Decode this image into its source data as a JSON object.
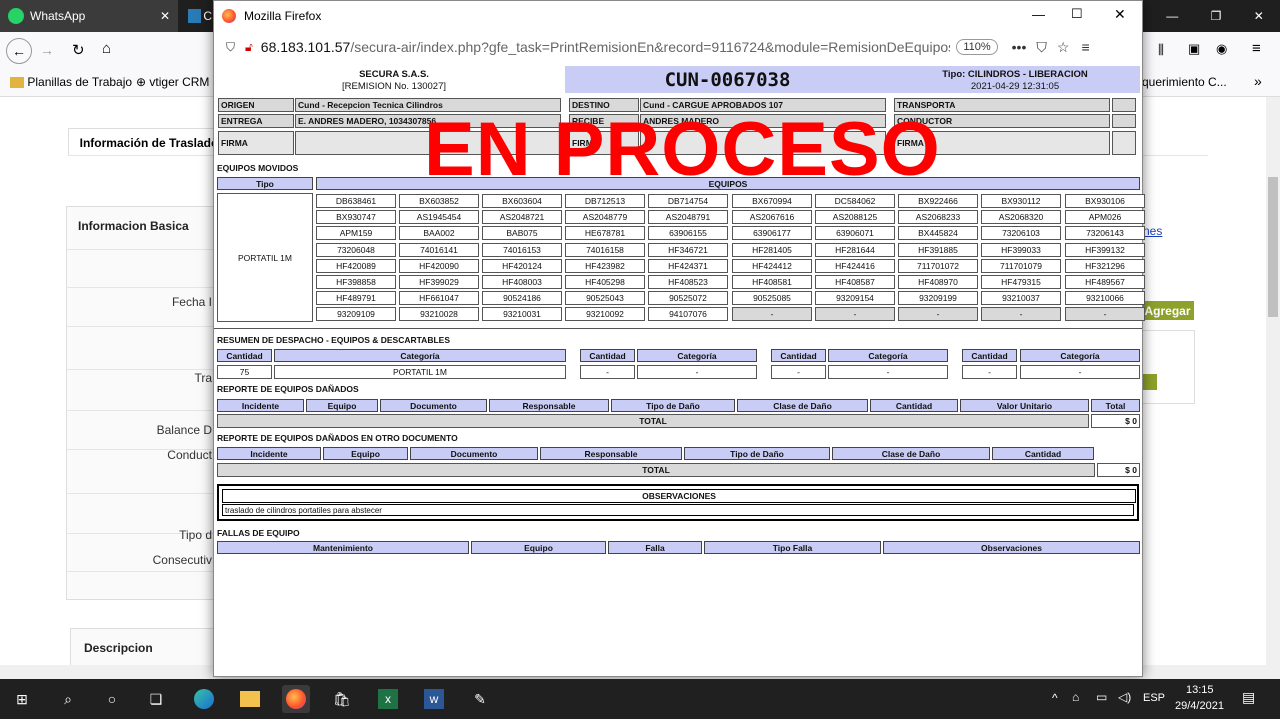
{
  "bg_tabs": {
    "whatsapp": "WhatsApp",
    "partial": "C"
  },
  "bg_bookmarks": {
    "planillas": "Planillas de Trabajo",
    "vtiger": "vtiger CRM",
    "right": "querimiento C..."
  },
  "bg_page": {
    "tab_title": "Información de Traslado",
    "section_basic": "Informacion Basica",
    "labels": [
      "Fecha I",
      "Tra",
      "Balance D",
      "Conduct",
      "Tipo d",
      "Consecutiv"
    ],
    "link_right": "nes",
    "button_agregar": "Agregar",
    "section_desc": "Descripcion"
  },
  "ff": {
    "title": "Mozilla Firefox",
    "url_host": "68.183.101.57",
    "url_path": "/secura-air/index.php?gfe_task=PrintRemisionEn&record=9116724&module=RemisionDeEquipos&actio",
    "zoom": "110%"
  },
  "doc": {
    "company": "SECURA S.A.S.",
    "remision": "[REMISION No. 130027]",
    "code": "CUN-0067038",
    "tipo": "Tipo: CILINDROS - LIBERACION",
    "datetime": "2021-04-29 12:31:05",
    "watermark": "EN PROCESO",
    "origen_label": "ORIGEN",
    "origen_value": "Cund - Recepcion Tecnica Cilindros",
    "destino_label": "DESTINO",
    "destino_value": "Cund - CARGUE APROBADOS 107",
    "transporta_label": "TRANSPORTA",
    "entrega_label": "ENTREGA",
    "entrega_value": "E. ANDRES MADERO, 1034307856",
    "recibe_label": "RECIBE",
    "recibe_value": "ANDRES MADERO",
    "conductor_label": "CONDUCTOR",
    "firma_label": "FIRMA",
    "equipos_movidos": "EQUIPOS MOVIDOS",
    "col_tipo": "Tipo",
    "col_equipos": "EQUIPOS",
    "tipo_value": "PORTATIL 1M",
    "equipos": [
      [
        "DB638461",
        "BX603852",
        "BX603604",
        "DB712513",
        "DB714754",
        "BX670994",
        "DC584062",
        "BX922466",
        "BX930112",
        "BX930106"
      ],
      [
        "BX930747",
        "AS1945454",
        "AS2048721",
        "AS2048779",
        "AS2048791",
        "AS2067616",
        "AS2088125",
        "AS2068233",
        "AS2068320",
        "APM026"
      ],
      [
        "APM159",
        "BAA002",
        "BAB075",
        "HE678781",
        "63906155",
        "63906177",
        "63906071",
        "BX445824",
        "73206103",
        "73206143"
      ],
      [
        "73206048",
        "74016141",
        "74016153",
        "74016158",
        "HF346721",
        "HF281405",
        "HF281644",
        "HF391885",
        "HF399033",
        "HF399132"
      ],
      [
        "HF420089",
        "HF420090",
        "HF420124",
        "HF423982",
        "HF424371",
        "HF424412",
        "HF424416",
        "711701072",
        "711701079",
        "HF321296"
      ],
      [
        "HF398858",
        "HF399029",
        "HF408003",
        "HF405298",
        "HF408523",
        "HF408581",
        "HF408587",
        "HF408970",
        "HF479315",
        "HF489567"
      ],
      [
        "HF489791",
        "HF661047",
        "90524186",
        "90525043",
        "90525072",
        "90525085",
        "93209154",
        "93209199",
        "93210037",
        "93210066"
      ],
      [
        "93209109",
        "93210028",
        "93210031",
        "93210092",
        "94107076",
        "-",
        "-",
        "-",
        "-",
        "-"
      ]
    ],
    "resumen_title": "RESUMEN DE DESPACHO - EQUIPOS & DESCARTABLES",
    "col_cantidad": "Cantidad",
    "col_categoria": "Categoría",
    "resumen_cantidad": "75",
    "resumen_categoria": "PORTATIL 1M",
    "dash": "-",
    "danados_title": "REPORTE DE EQUIPOS DAÑADOS",
    "danados_cols": [
      "Incidente",
      "Equipo",
      "Documento",
      "Responsable",
      "Tipo de Daño",
      "Clase de Daño",
      "Cantidad",
      "Valor Unitario",
      "Total"
    ],
    "total_label": "TOTAL",
    "total_value": "$ 0",
    "otro_title": "REPORTE DE EQUIPOS DAÑADOS EN OTRO DOCUMENTO",
    "otro_cols": [
      "Incidente",
      "Equipo",
      "Documento",
      "Responsable",
      "Tipo de Daño",
      "Clase de Daño",
      "Cantidad"
    ],
    "observaciones_title": "OBSERVACIONES",
    "observaciones_text": "traslado de cilindros portatiles para abstecer",
    "fallas_title": "FALLAS DE EQUIPO",
    "fallas_cols": [
      "Mantenimiento",
      "Equipo",
      "Falla",
      "Tipo Falla",
      "Observaciones"
    ]
  },
  "taskbar": {
    "time": "13:15",
    "date": "29/4/2021",
    "lang": "ESP"
  }
}
